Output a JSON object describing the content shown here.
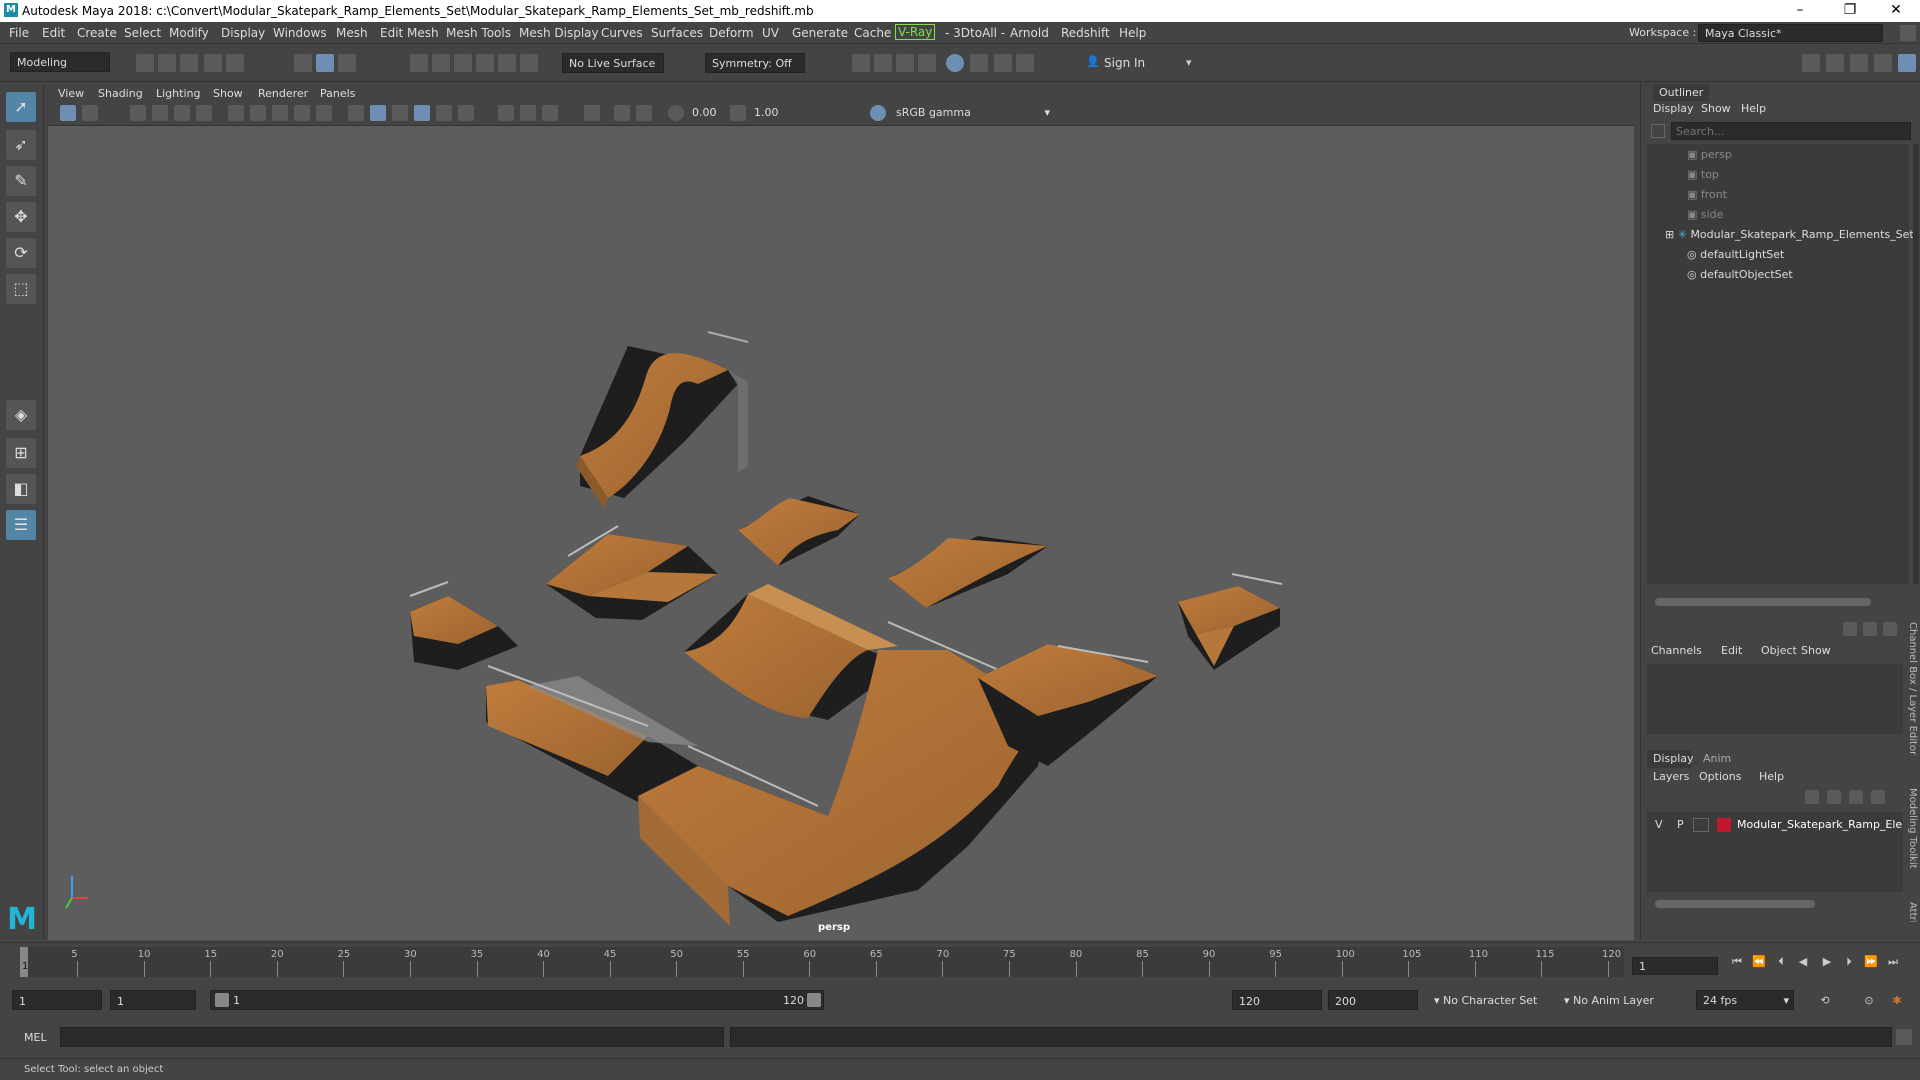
{
  "window": {
    "title": "Autodesk Maya 2018: c:\\Convert\\Modular_Skatepark_Ramp_Elements_Set\\Modular_Skatepark_Ramp_Elements_Set_mb_redshift.mb",
    "minimize": "–",
    "maximize": "❐",
    "close": "✕"
  },
  "menubar": {
    "items": [
      "File",
      "Edit",
      "Create",
      "Select",
      "Modify",
      "Display",
      "Windows",
      "Mesh",
      "Edit Mesh",
      "Mesh Tools",
      "Mesh Display",
      "Curves",
      "Surfaces",
      "Deform",
      "UV",
      "Generate",
      "Cache",
      "V-Ray",
      "- 3DtoAll -",
      "Arnold",
      "Redshift",
      "Help"
    ],
    "workspace_label": "Workspace :",
    "workspace_value": "Maya Classic*"
  },
  "shelf": {
    "mode": "Modeling",
    "live_surface": "No Live Surface",
    "symmetry": "Symmetry: Off",
    "sign_in": "Sign In"
  },
  "viewport": {
    "menus": [
      "View",
      "Shading",
      "Lighting",
      "Show",
      "Renderer",
      "Panels"
    ],
    "exposure": "0.00",
    "gamma": "1.00",
    "color_space": "sRGB gamma",
    "camera_label": "persp"
  },
  "outliner": {
    "title": "Outliner",
    "menus": [
      "Display",
      "Show",
      "Help"
    ],
    "search_placeholder": "Search...",
    "items": [
      "persp",
      "top",
      "front",
      "side",
      "Modular_Skatepark_Ramp_Elements_Set",
      "defaultLightSet",
      "defaultObjectSet"
    ]
  },
  "channelbox": {
    "menus": [
      "Channels",
      "Edit",
      "Object",
      "Show"
    ],
    "side_tab": "Channel Box / Layer Editor",
    "side_tab2": "Modeling Toolkit",
    "side_tab3": "Attribute Editor"
  },
  "layers": {
    "tabs": [
      "Display",
      "Anim"
    ],
    "menus": [
      "Layers",
      "Options",
      "Help"
    ],
    "layer_v": "V",
    "layer_p": "P",
    "layer_name": "Modular_Skatepark_Ramp_Ele",
    "layer_color": "#c0182e"
  },
  "timeline": {
    "ticks": [
      "1",
      "5",
      "10",
      "15",
      "20",
      "25",
      "30",
      "35",
      "40",
      "45",
      "50",
      "55",
      "60",
      "65",
      "70",
      "75",
      "80",
      "85",
      "90",
      "95",
      "100",
      "105",
      "110",
      "115",
      "120"
    ],
    "current_frame": "1"
  },
  "range": {
    "start": "1",
    "start_inner": "1",
    "slider_start": "1",
    "slider_end": "120",
    "end_inner": "120",
    "end": "200",
    "char_set": "No Character Set",
    "anim_layer": "No Anim Layer",
    "fps": "24 fps"
  },
  "mel": {
    "label": "MEL"
  },
  "status": {
    "text": "Select Tool: select an object"
  }
}
